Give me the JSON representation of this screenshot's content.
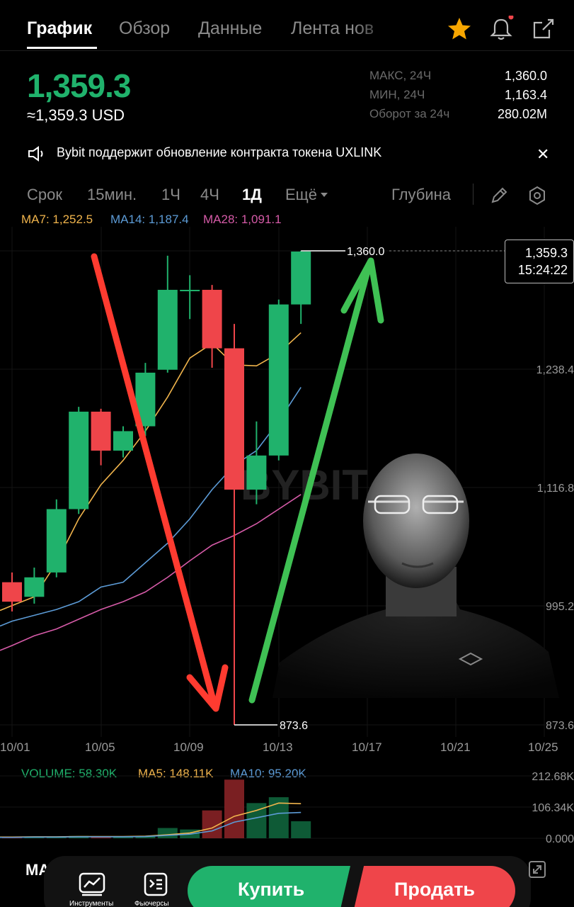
{
  "tabs": [
    {
      "label": "График"
    },
    {
      "label": "Обзор"
    },
    {
      "label": "Данные"
    },
    {
      "label": "Лента нов"
    }
  ],
  "ticker": {
    "price": "1,359.3",
    "price_usd": "≈1,359.3 USD",
    "stats": [
      {
        "label": "МАКС, 24Ч",
        "value": "1,360.0"
      },
      {
        "label": "МИН, 24Ч",
        "value": "1,163.4"
      },
      {
        "label": "Оборот за 24ч",
        "value": "280.02M"
      }
    ]
  },
  "notice": {
    "text": "Bybit поддержит обновление контракта токена UXLINK",
    "close": "✕"
  },
  "timeframes": [
    {
      "label": "Срок"
    },
    {
      "label": "15мин."
    },
    {
      "label": "1Ч"
    },
    {
      "label": "4Ч"
    },
    {
      "label": "1Д"
    },
    {
      "label": "Ещё"
    }
  ],
  "depth_label": "Глубина",
  "ma_legend": {
    "ma7": "MA7: 1,252.5",
    "ma14": "MA14: 1,187.4",
    "ma28": "MA28: 1,091.1"
  },
  "current_tag": {
    "price": "1,359.3",
    "time": "15:24:22"
  },
  "colors": {
    "up": "#20b26c",
    "down": "#ef454a",
    "ma7": "#f0b44c",
    "ma14": "#5c9bd6",
    "ma28": "#d65ba8",
    "arrow_red": "#ff3b30",
    "arrow_green": "#3fc154"
  },
  "watermark": "BYBIT",
  "chart_data": {
    "type": "candlestick",
    "x_ticks": [
      "10/01",
      "10/05",
      "10/09",
      "10/13",
      "10/17",
      "10/21",
      "10/25"
    ],
    "y_ticks": [
      "1,238.4",
      "1,116.8",
      "995.2",
      "873.6"
    ],
    "ylim": [
      873.6,
      1360.0
    ],
    "high_label": "1,360.0",
    "low_label": "873.6",
    "candles": [
      {
        "o": 1020,
        "c": 1000,
        "h": 1030,
        "l": 990
      },
      {
        "o": 1005,
        "c": 1025,
        "h": 1035,
        "l": 998
      },
      {
        "o": 1030,
        "c": 1095,
        "h": 1105,
        "l": 1025
      },
      {
        "o": 1095,
        "c": 1195,
        "h": 1200,
        "l": 1090
      },
      {
        "o": 1195,
        "c": 1155,
        "h": 1198,
        "l": 1140
      },
      {
        "o": 1155,
        "c": 1175,
        "h": 1180,
        "l": 1148
      },
      {
        "o": 1180,
        "c": 1235,
        "h": 1245,
        "l": 1170
      },
      {
        "o": 1238,
        "c": 1320,
        "h": 1355,
        "l": 1235
      },
      {
        "o": 1320,
        "c": 1320,
        "h": 1335,
        "l": 1290
      },
      {
        "o": 1320,
        "c": 1260,
        "h": 1325,
        "l": 1240
      },
      {
        "o": 1260,
        "c": 1115,
        "h": 1285,
        "l": 873.6
      },
      {
        "o": 1115,
        "c": 1150,
        "h": 1185,
        "l": 1100
      },
      {
        "o": 1150,
        "c": 1305,
        "h": 1310,
        "l": 1145
      },
      {
        "o": 1305,
        "c": 1359.3,
        "h": 1360,
        "l": 1285
      }
    ],
    "ma7": [
      996,
      1005,
      1040,
      1085,
      1120,
      1145,
      1175,
      1210,
      1250,
      1265,
      1243,
      1242,
      1255,
      1276
    ],
    "ma14": [
      980,
      986,
      992,
      1000,
      1015,
      1020,
      1040,
      1060,
      1085,
      1115,
      1140,
      1155,
      1185,
      1220
    ],
    "ma28": [
      955,
      965,
      972,
      982,
      992,
      1000,
      1010,
      1025,
      1042,
      1058,
      1068,
      1080,
      1095,
      1110
    ]
  },
  "volume": {
    "legend": {
      "vol": "VOLUME: 58.30K",
      "ma5": "MA5: 148.11K",
      "ma10": "MA10: 95.20K"
    },
    "y_ticks": [
      "212.68K",
      "106.34K",
      "0.000"
    ],
    "bars": [
      3,
      5,
      6,
      8,
      6,
      5,
      7,
      35,
      30,
      95,
      200,
      120,
      140,
      58
    ],
    "ma5": [
      4,
      5,
      5,
      6,
      6,
      6,
      7,
      12,
      18,
      35,
      75,
      95,
      120,
      118
    ],
    "ma10": [
      3,
      4,
      4,
      5,
      5,
      5,
      6,
      10,
      14,
      25,
      55,
      70,
      85,
      88
    ]
  },
  "bottom": {
    "ma_label": "MA",
    "nav": [
      {
        "label": "Инструменты"
      },
      {
        "label": "Фьючерсы"
      }
    ],
    "buy": "Купить",
    "sell": "Продать"
  }
}
